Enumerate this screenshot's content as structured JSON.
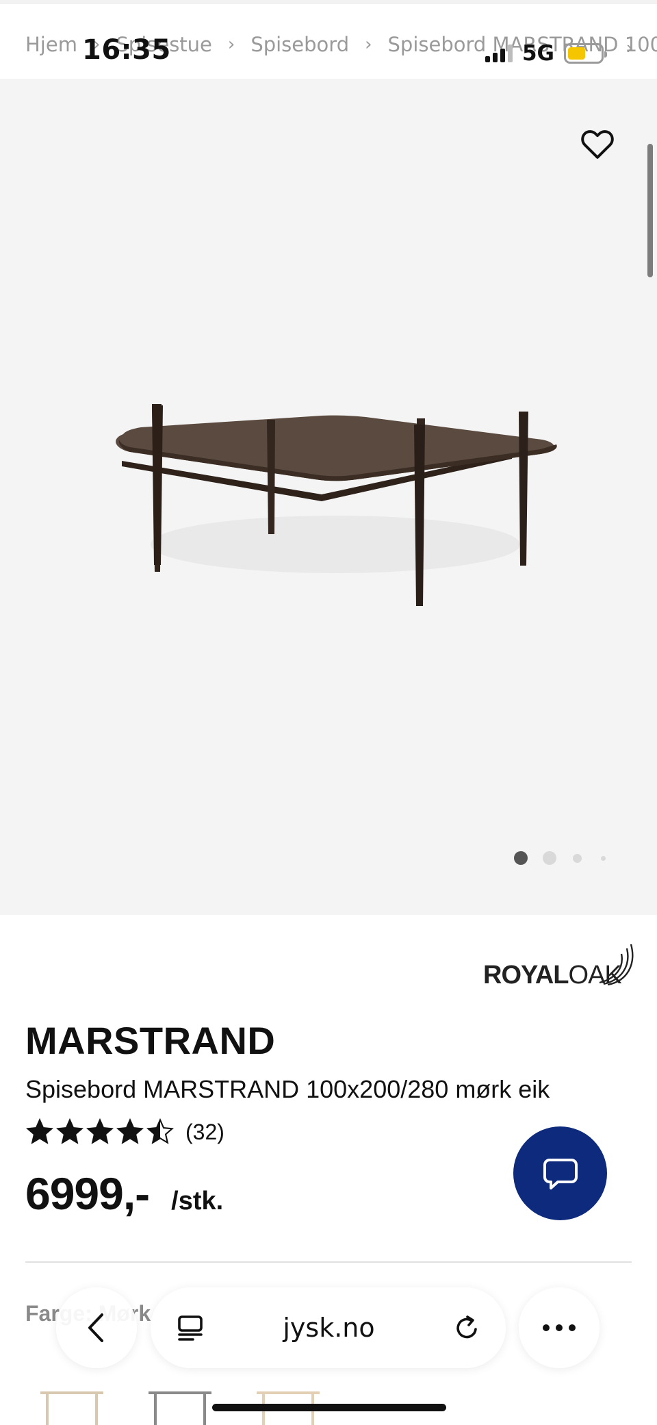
{
  "status_bar": {
    "time": "16:35",
    "network": "5G",
    "battery_level": 0.55,
    "battery_color": "#f5c500"
  },
  "breadcrumb": {
    "items": [
      "Hjem",
      "Spisestue",
      "Spisebord",
      "Spisebord MARSTRAND 100"
    ],
    "separator": "›",
    "trailing": "›"
  },
  "gallery": {
    "image_count": 4,
    "active_index": 0,
    "active_dot_color": "#555555"
  },
  "product": {
    "brand_logo": {
      "bold": "ROYAL",
      "light": "OAK"
    },
    "name": "MARSTRAND",
    "description": "Spisebord MARSTRAND 100x200/280 mørk eik",
    "rating": {
      "stars": 4.5,
      "max": 5,
      "count_label": "(32)"
    },
    "price": "6999,-",
    "unit": "/stk.",
    "color_label": "Farge: Mørk"
  },
  "chat": {
    "color": "#0d2a7c"
  },
  "browser": {
    "url": "jysk.no"
  }
}
